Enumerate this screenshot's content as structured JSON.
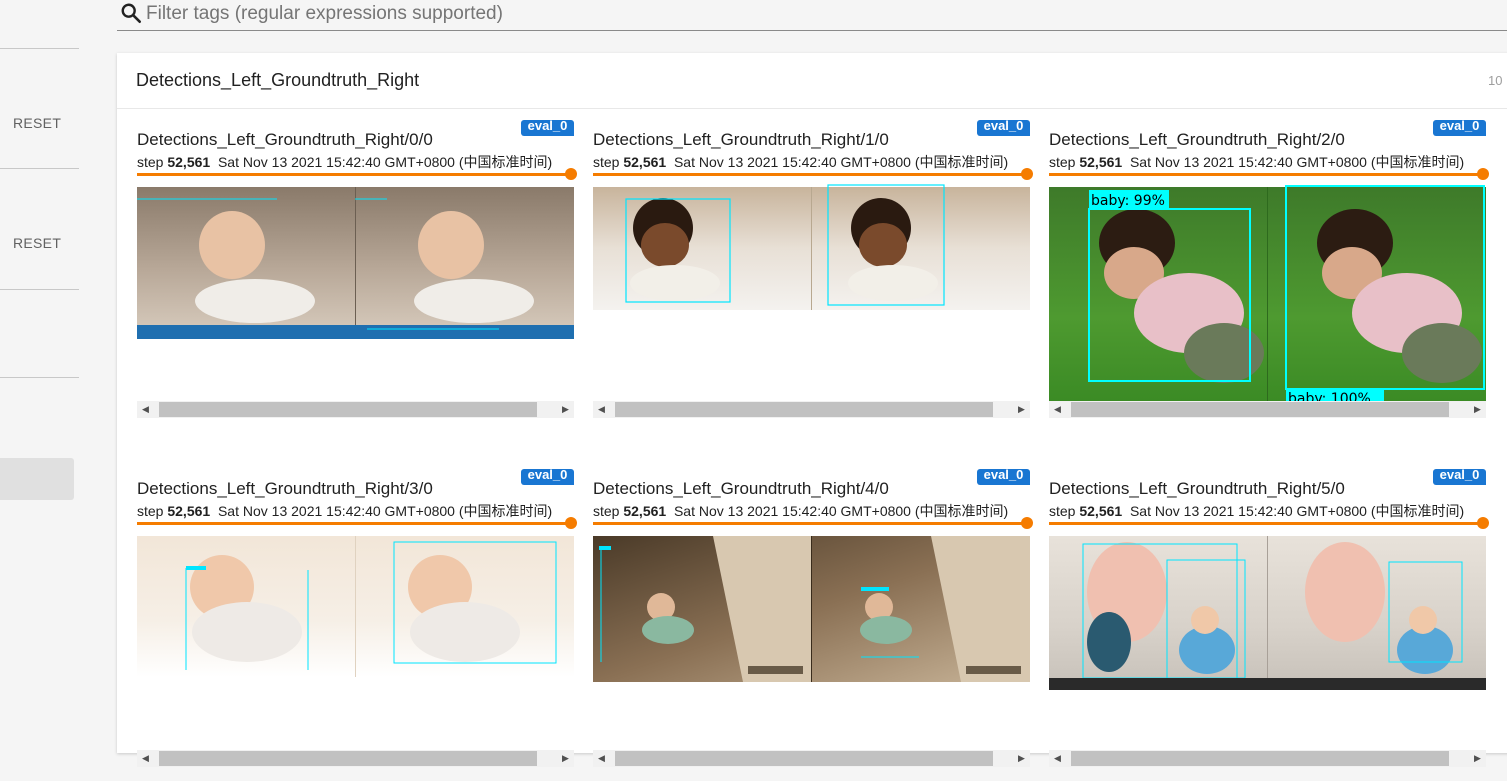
{
  "filter": {
    "placeholder": "Filter tags (regular expressions supported)"
  },
  "sidebar": {
    "reset_1": "RESET",
    "reset_2": "RESET"
  },
  "card": {
    "title": "Detections_Left_Groundtruth_Right",
    "count": "10"
  },
  "colors": {
    "accent": "#f57c00",
    "chip": "#1976d2",
    "box": "#00ffff"
  },
  "tiles": [
    {
      "name": "Detections_Left_Groundtruth_Right/0/0",
      "run": "eval_0",
      "step_prefix": "step",
      "step": "52,561",
      "time": "Sat Nov 13 2021 15:42:40 GMT+0800 (中国标准时间)"
    },
    {
      "name": "Detections_Left_Groundtruth_Right/1/0",
      "run": "eval_0",
      "step_prefix": "step",
      "step": "52,561",
      "time": "Sat Nov 13 2021 15:42:40 GMT+0800 (中国标准时间)"
    },
    {
      "name": "Detections_Left_Groundtruth_Right/2/0",
      "run": "eval_0",
      "step_prefix": "step",
      "step": "52,561",
      "time": "Sat Nov 13 2021 15:42:40 GMT+0800 (中国标准时间)",
      "left_label": "baby: 99%",
      "right_label": "baby: 100%"
    },
    {
      "name": "Detections_Left_Groundtruth_Right/3/0",
      "run": "eval_0",
      "step_prefix": "step",
      "step": "52,561",
      "time": "Sat Nov 13 2021 15:42:40 GMT+0800 (中国标准时间)"
    },
    {
      "name": "Detections_Left_Groundtruth_Right/4/0",
      "run": "eval_0",
      "step_prefix": "step",
      "step": "52,561",
      "time": "Sat Nov 13 2021 15:42:40 GMT+0800 (中国标准时间)"
    },
    {
      "name": "Detections_Left_Groundtruth_Right/5/0",
      "run": "eval_0",
      "step_prefix": "step",
      "step": "52,561",
      "time": "Sat Nov 13 2021 15:42:40 GMT+0800 (中国标准时间)"
    }
  ]
}
